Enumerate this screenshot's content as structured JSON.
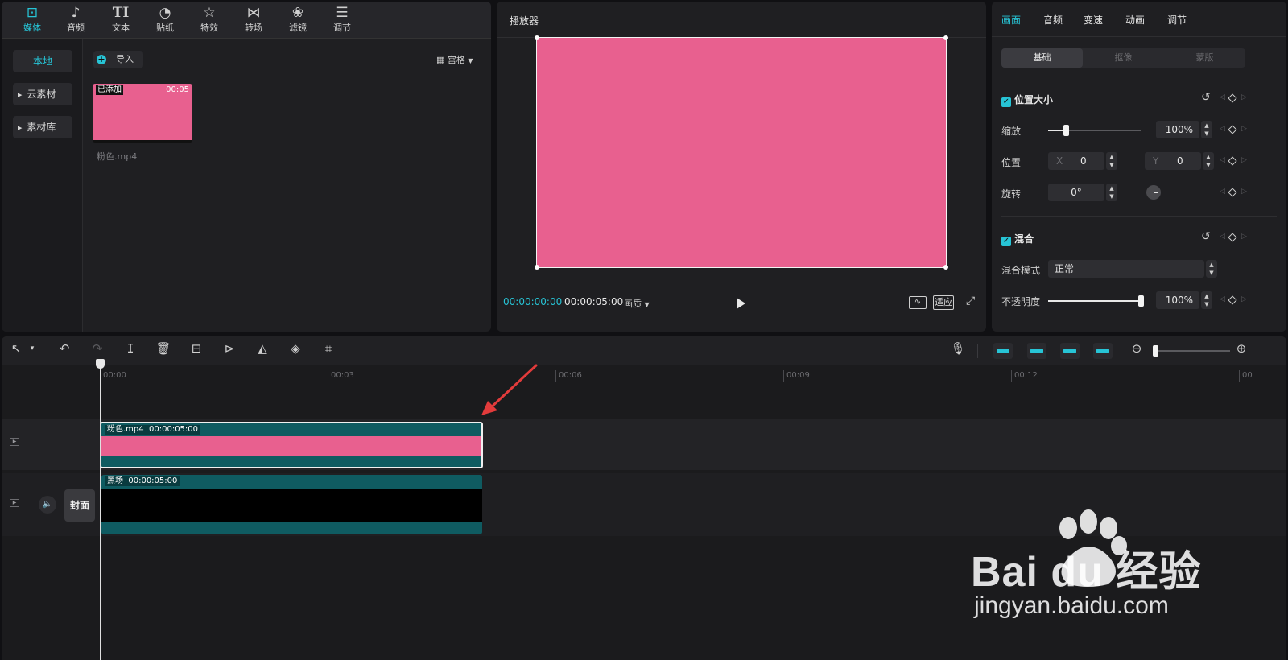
{
  "media_tabs": [
    {
      "label": "媒体",
      "icon": "media-play-icon"
    },
    {
      "label": "音频",
      "icon": "music-note-icon"
    },
    {
      "label": "文本",
      "icon": "text-icon"
    },
    {
      "label": "贴纸",
      "icon": "sticker-icon"
    },
    {
      "label": "特效",
      "icon": "effects-star-icon"
    },
    {
      "label": "转场",
      "icon": "transition-bowtie-icon"
    },
    {
      "label": "滤镜",
      "icon": "filter-circles-icon"
    },
    {
      "label": "调节",
      "icon": "sliders-icon"
    }
  ],
  "sidebar": {
    "local": "本地",
    "cloud": "云素材",
    "library": "素材库"
  },
  "media": {
    "import_label": "导入",
    "grid_label": "宫格",
    "thumb": {
      "added_badge": "已添加",
      "duration": "00:05",
      "filename": "粉色.mp4"
    }
  },
  "player": {
    "title": "播放器",
    "current_time": "00:00:00:00",
    "total_time": "00:00:05:00",
    "quality_label": "画质",
    "fit_label": "适应"
  },
  "props": {
    "tabs": [
      "画面",
      "音频",
      "变速",
      "动画",
      "调节"
    ],
    "segments": [
      "基础",
      "抠像",
      "蒙版"
    ],
    "position_section": "位置大小",
    "scale_label": "缩放",
    "scale_value": "100%",
    "scale_fraction": 0.2,
    "position_label": "位置",
    "x_prefix": "X",
    "x_value": "0",
    "y_prefix": "Y",
    "y_value": "0",
    "rotate_label": "旋转",
    "rotate_value": "0°",
    "blend_section": "混合",
    "blend_mode_label": "混合模式",
    "blend_mode_value": "正常",
    "opacity_label": "不透明度",
    "opacity_value": "100%",
    "opacity_fraction": 1.0
  },
  "timeline": {
    "ruler": [
      "00:00",
      "00:03",
      "00:06",
      "00:09",
      "00:12",
      "00"
    ],
    "clip1": {
      "name": "粉色.mp4",
      "duration": "00:00:05:00"
    },
    "clip2": {
      "name": "黑场",
      "duration": "00:00:05:00"
    },
    "cover_label": "封面"
  },
  "watermark": {
    "brand": "Bai du 经验",
    "url": "jingyan.baidu.com"
  },
  "colors": {
    "accent": "#27c4d6",
    "pink": "#e8608f",
    "clip_teal": "#0f5b61",
    "arrow": "#e23b3b"
  }
}
